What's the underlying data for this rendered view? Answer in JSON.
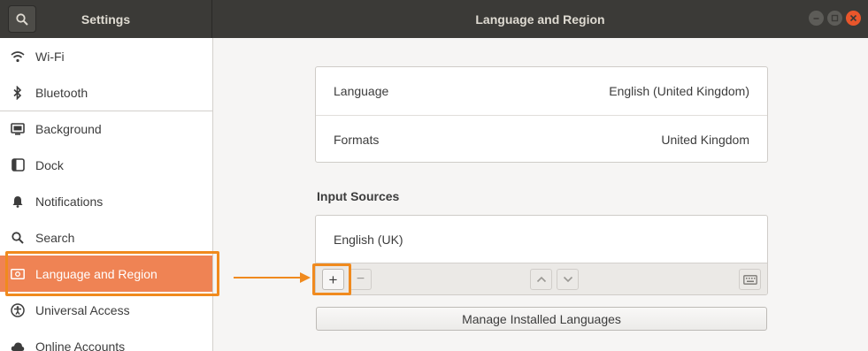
{
  "app": {
    "sidebar_title": "Settings",
    "window_title": "Language and Region"
  },
  "colors": {
    "accent": "#ef8354",
    "highlight": "#f08a1e",
    "headerbar": "#3b3a37",
    "close": "#e9562b"
  },
  "sidebar": {
    "items": [
      {
        "label": "Wi-Fi",
        "icon": "wifi-icon"
      },
      {
        "label": "Bluetooth",
        "icon": "bluetooth-icon"
      },
      {
        "label": "Background",
        "icon": "background-icon"
      },
      {
        "label": "Dock",
        "icon": "dock-icon"
      },
      {
        "label": "Notifications",
        "icon": "bell-icon"
      },
      {
        "label": "Search",
        "icon": "search-icon"
      },
      {
        "label": "Language and Region",
        "icon": "flag-icon",
        "active": true
      },
      {
        "label": "Universal Access",
        "icon": "accessibility-icon"
      },
      {
        "label": "Online Accounts",
        "icon": "cloud-icon"
      }
    ]
  },
  "main": {
    "settings": [
      {
        "key": "Language",
        "value": "English (United Kingdom)"
      },
      {
        "key": "Formats",
        "value": "United Kingdom"
      }
    ],
    "input_sources_title": "Input Sources",
    "input_sources": [
      "English (UK)"
    ],
    "toolbar": {
      "add": "+",
      "remove": "−"
    },
    "manage_button": "Manage Installed Languages"
  }
}
